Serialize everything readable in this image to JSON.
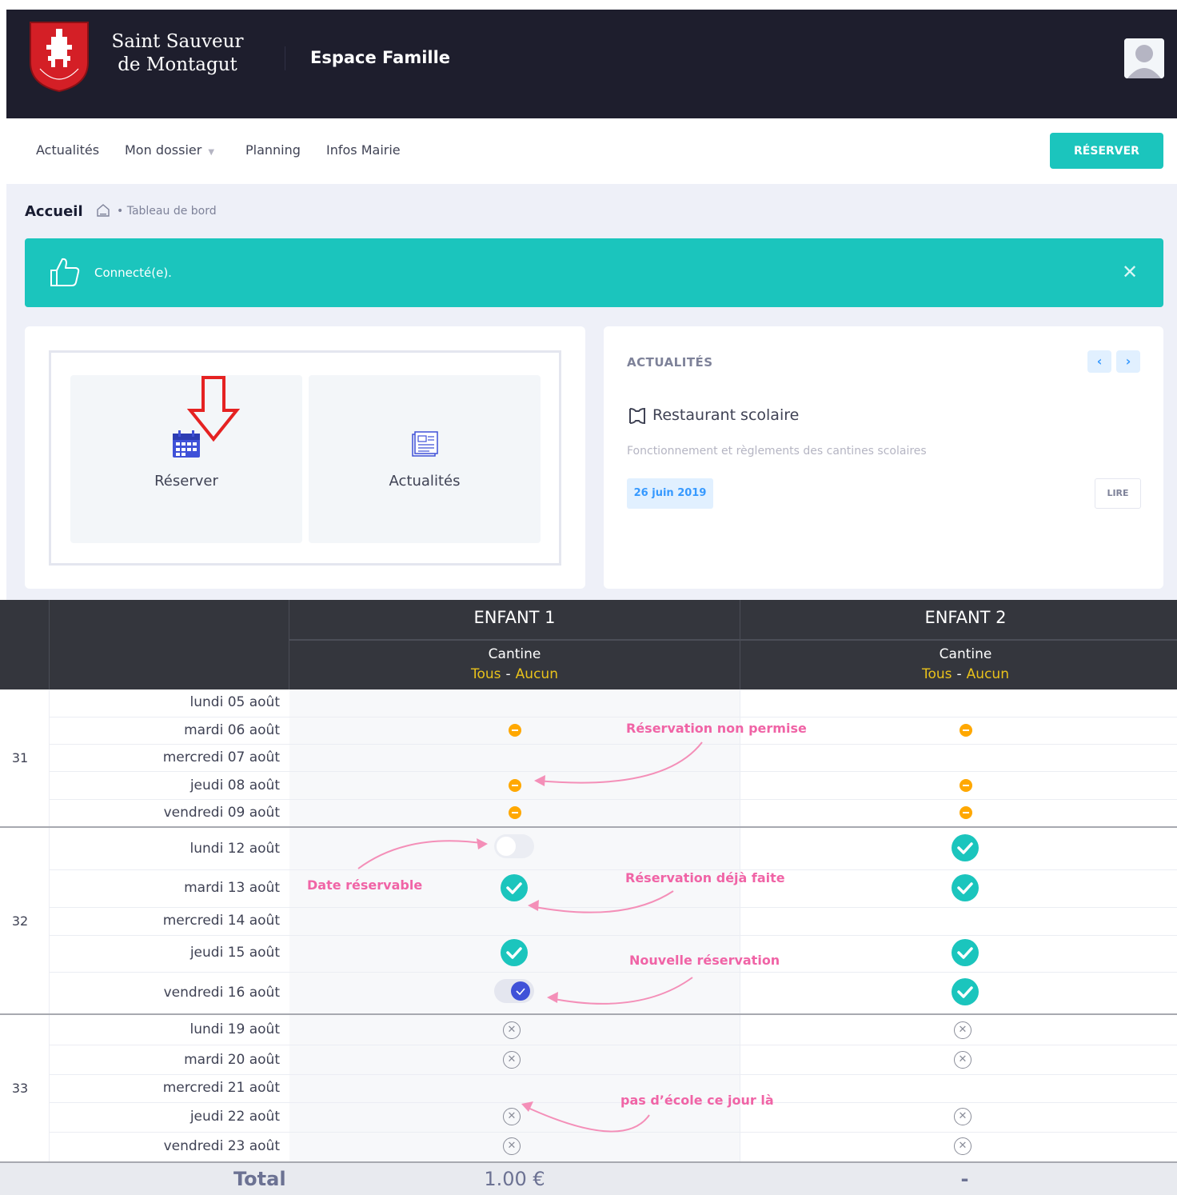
{
  "header": {
    "city_line1": "Saint Sauveur",
    "city_line2": "de Montagut",
    "espace": "Espace Famille",
    "logo_icon": "city-coat-of-arms",
    "user_icon": "user-avatar-icon"
  },
  "nav": {
    "items": [
      "Actualités",
      "Mon dossier",
      "Planning",
      "Infos Mairie"
    ],
    "reserve_button": "RÉSERVER"
  },
  "breadcrumb": {
    "title": "Accueil",
    "path": "Tableau de bord"
  },
  "alert": {
    "message": "Connecté(e)."
  },
  "tiles": [
    {
      "label": "Réserver",
      "icon": "calendar-icon"
    },
    {
      "label": "Actualités",
      "icon": "news-icon"
    }
  ],
  "news": {
    "heading": "ACTUALITÉS",
    "title": "Restaurant scolaire",
    "description": "Fonctionnement et règlements des cantines scolaires",
    "date": "26 juin 2019",
    "read_label": "LIRE"
  },
  "planning": {
    "children": [
      {
        "name": "ENFANT 1",
        "service": "Cantine",
        "opt_all": "Tous",
        "opt_sep": "-",
        "opt_none": "Aucun"
      },
      {
        "name": "ENFANT 2",
        "service": "Cantine",
        "opt_all": "Tous",
        "opt_sep": "-",
        "opt_none": "Aucun"
      }
    ],
    "weeks": [
      "31",
      "32",
      "33"
    ],
    "days": [
      "lundi 05 août",
      "mardi 06 août",
      "mercredi 07 août",
      "jeudi 08 août",
      "vendredi 09 août",
      "lundi 12 août",
      "mardi 13 août",
      "mercredi 14 août",
      "jeudi 15 août",
      "vendredi 16 août",
      "lundi 19 août",
      "mardi 20 août",
      "mercredi 21 août",
      "jeudi 22 août",
      "vendredi 23 août"
    ],
    "annotations": {
      "non_permise": "Réservation non permise",
      "reservable": "Date réservable",
      "deja_faite": "Réservation déjà faite",
      "nouvelle": "Nouvelle réservation",
      "pas_ecole": "pas d’école ce jour là"
    },
    "total_label": "Total",
    "total_child1": "1.00 €",
    "total_child2": "-",
    "status_colors": {
      "not_allowed": "#ffa800",
      "booked": "#1bc5bd",
      "new": "#3f51d8",
      "annotation": "#f064a6"
    }
  }
}
